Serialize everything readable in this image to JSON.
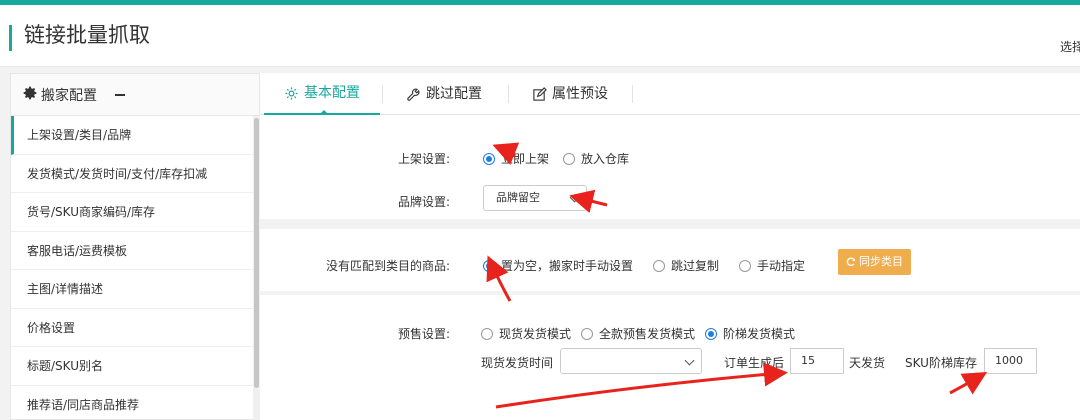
{
  "header": {
    "title": "链接批量抓取",
    "select_link": "选择"
  },
  "sidebar": {
    "title": "搬家配置",
    "items": [
      {
        "label": "上架设置/类目/品牌"
      },
      {
        "label": "发货模式/发货时间/支付/库存扣减"
      },
      {
        "label": "货号/SKU商家编码/库存"
      },
      {
        "label": "客服电话/运费模板"
      },
      {
        "label": "主图/详情描述"
      },
      {
        "label": "价格设置"
      },
      {
        "label": "标题/SKU别名"
      },
      {
        "label": "推荐语/同店商品推荐"
      }
    ]
  },
  "tabs": [
    {
      "label": "基本配置",
      "icon": "gear-icon"
    },
    {
      "label": "跳过配置",
      "icon": "wrench-icon"
    },
    {
      "label": "属性预设",
      "icon": "edit-icon"
    }
  ],
  "form": {
    "listing": {
      "label": "上架设置:",
      "options": [
        "立即上架",
        "放入仓库"
      ],
      "selected": 0
    },
    "brand": {
      "label": "品牌设置:",
      "value": "品牌留空"
    },
    "unmatched": {
      "label": "没有匹配到类目的商品:",
      "options": [
        "置为空，搬家时手动设置",
        "跳过复制",
        "手动指定"
      ],
      "selected": 0,
      "sync_button": "同步类目"
    },
    "presale": {
      "label": "预售设置:",
      "options": [
        "现货发货模式",
        "全款预售发货模式",
        "阶梯发货模式"
      ],
      "selected": 2,
      "ship_time_label": "现货发货时间",
      "ship_time_value": "",
      "order_label": "订单生成后",
      "order_days": "15",
      "days_suffix": "天发货",
      "sku_stock_label": "SKU阶梯库存",
      "sku_stock_value": "1000"
    }
  },
  "colors": {
    "accent": "#18a99d",
    "radio": "#1e7de0",
    "sync": "#f0ad4e",
    "annotation": "#e8231d"
  }
}
